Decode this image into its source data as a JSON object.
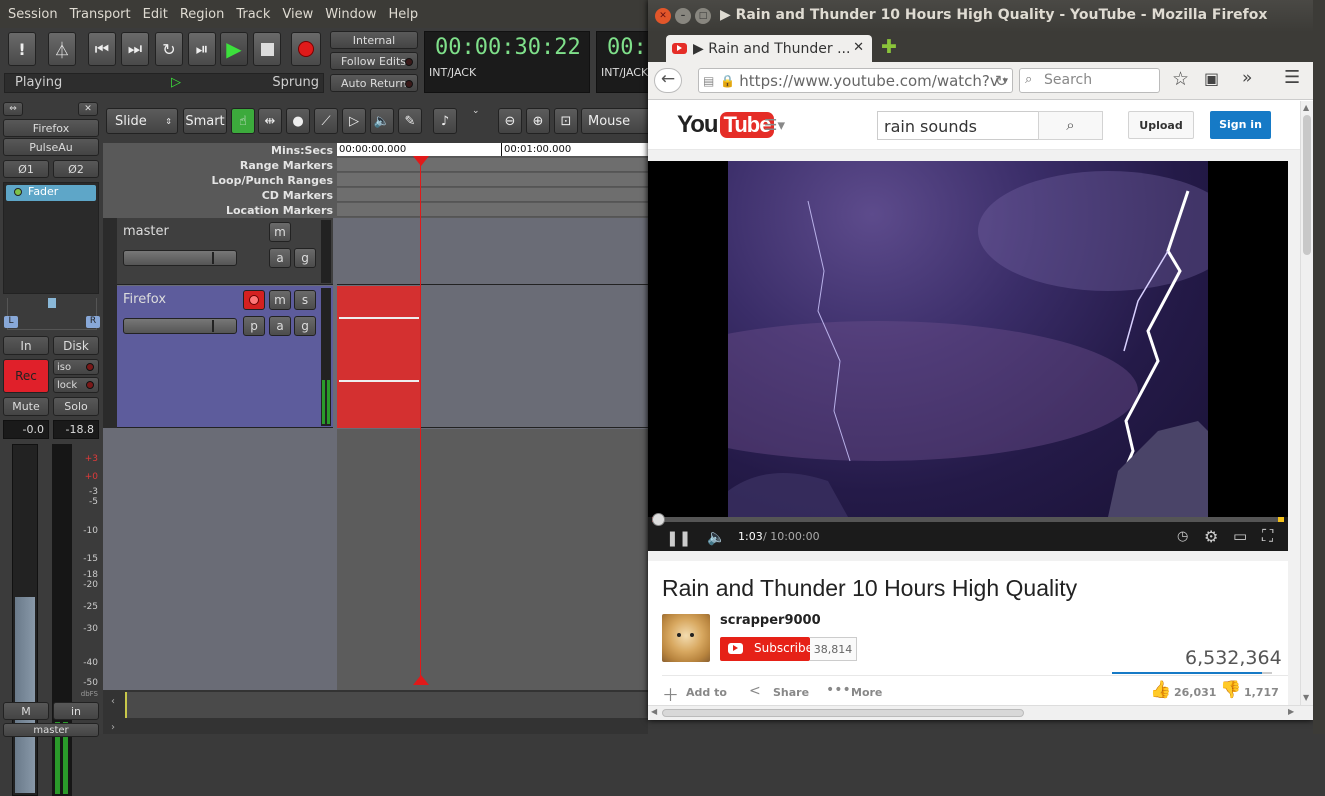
{
  "ardour": {
    "menu": [
      "Session",
      "Transport",
      "Edit",
      "Region",
      "Track",
      "View",
      "Window",
      "Help"
    ],
    "status_left": "Playing",
    "status_right": "Sprung",
    "sync_buttons": [
      "Internal",
      "Follow Edits",
      "Auto Return"
    ],
    "primary_clock": "00:00:30:22",
    "primary_clock_sub": "INT/JACK",
    "secondary_clock": "00:",
    "secondary_clock_sub": "INT/JACK",
    "strip": {
      "name": "Firefox",
      "input": "PulseAu",
      "phase1": "Ø1",
      "phase2": "Ø2",
      "plugin": "Fader",
      "pan_l": "L",
      "pan_r": "R",
      "in": "In",
      "disk": "Disk",
      "rec": "Rec",
      "iso": "iso",
      "lock": "lock",
      "mute": "Mute",
      "solo": "Solo",
      "gain": "-0.0",
      "peak": "-18.8",
      "meter_ticks": [
        "+3",
        "+0",
        "-3",
        "-5",
        "-10",
        "-15",
        "-18",
        "-20",
        "-25",
        "-30",
        "-40",
        "-50"
      ],
      "meter_unit": "dbFS",
      "m": "M",
      "in2": "in",
      "bottom": "master"
    },
    "edit_mode": "Slide",
    "tool_mode": "Smart",
    "mouse_label": "Mouse",
    "rulers": [
      "Mins:Secs",
      "Range Markers",
      "Loop/Punch Ranges",
      "CD Markers",
      "Location Markers"
    ],
    "ruler_times": [
      "00:00:00.000",
      "00:01:00.000"
    ],
    "tracks": [
      {
        "name": "master",
        "buttons": [
          "m",
          "a",
          "g"
        ]
      },
      {
        "name": "Firefox",
        "buttons": [
          "m",
          "s",
          "p",
          "a",
          "g"
        ]
      }
    ]
  },
  "firefox": {
    "window_title": "▶ Rain and Thunder 10 Hours High Quality - YouTube - Mozilla Firefox",
    "tab_title": "▶ Rain and Thunder ...",
    "url": "https://www.youtube.com/watch?v",
    "search_placeholder": "Search"
  },
  "youtube": {
    "logo_you": "You",
    "logo_tube": "Tube",
    "search_value": "rain sounds",
    "upload": "Upload",
    "signin": "Sign in",
    "time_current": "1:03",
    "time_total": "/ 10:00:00",
    "progress_fraction": 0.0017,
    "video_title": "Rain and Thunder 10 Hours High Quality",
    "channel": "scrapper9000",
    "subscribe": "Subscribe",
    "subscribers": "38,814",
    "views": "6,532,364",
    "add_to": "Add to",
    "share": "Share",
    "more": "More",
    "likes": "26,031",
    "dislikes": "1,717",
    "like_ratio": 0.938
  }
}
